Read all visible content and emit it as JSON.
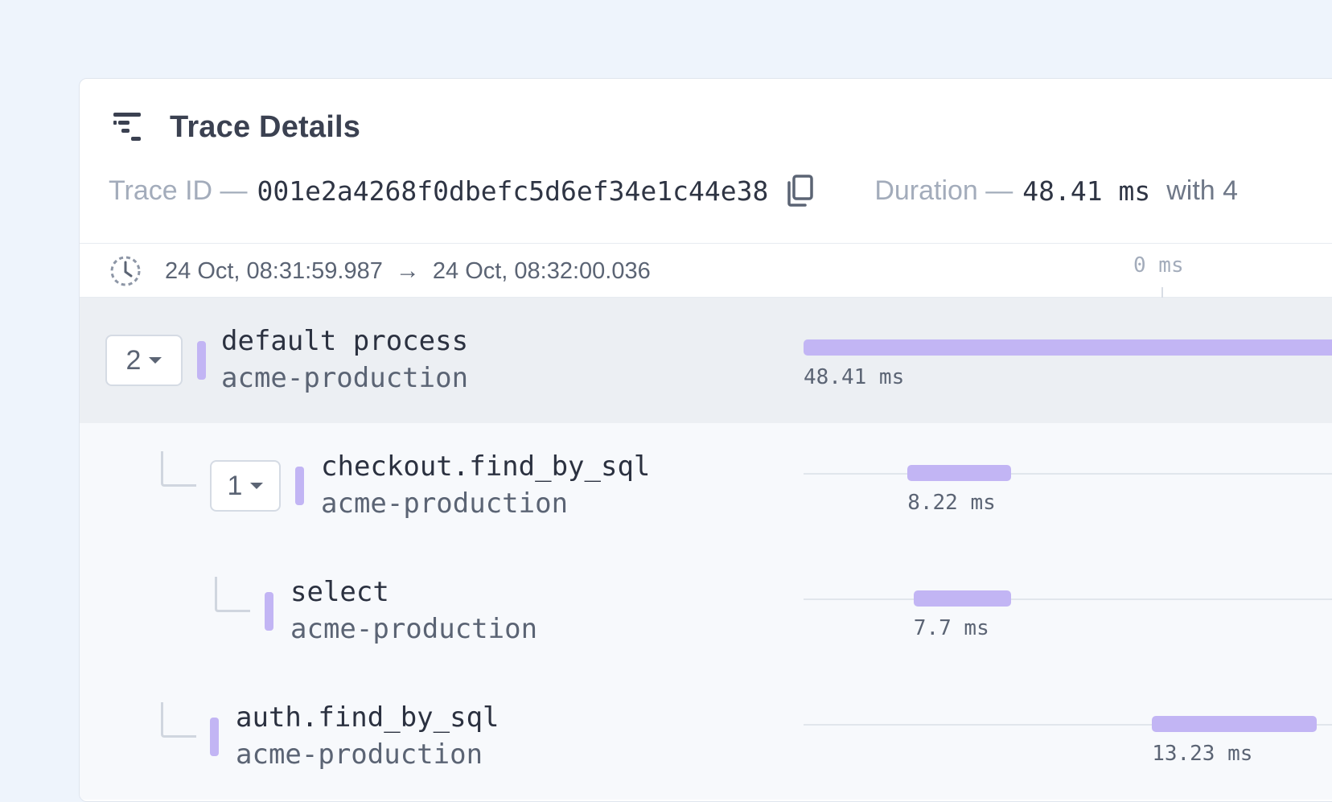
{
  "header": {
    "title": "Trace Details",
    "trace_id_label": "Trace ID —",
    "trace_id": "001e2a4268f0dbefc5d6ef34e1c44e38",
    "duration_label": "Duration —",
    "duration": "48.41 ms",
    "with_text": "with 4"
  },
  "time_range": {
    "start": "24 Oct, 08:31:59.987",
    "end": "24 Oct, 08:32:00.036",
    "timeline_start_label": "0 ms"
  },
  "spans": [
    {
      "name": "default process",
      "service": "acme-production",
      "duration": "48.41 ms",
      "children_count": "2",
      "offset_fraction": 0.0,
      "width_fraction": 1.0
    },
    {
      "name": "checkout.find_by_sql",
      "service": "acme-production",
      "duration": "8.22 ms",
      "children_count": "1",
      "offset_fraction": 0.17,
      "width_fraction": 0.17
    },
    {
      "name": "select",
      "service": "acme-production",
      "duration": "7.7 ms",
      "children_count": "",
      "offset_fraction": 0.18,
      "width_fraction": 0.16
    },
    {
      "name": "auth.find_by_sql",
      "service": "acme-production",
      "duration": "13.23 ms",
      "children_count": "",
      "offset_fraction": 0.57,
      "width_fraction": 0.27
    }
  ],
  "colors": {
    "span_bar": "#c2b5f4",
    "selected_row_bg": "#eceff3",
    "page_bg": "#eef4fc"
  },
  "icons": {
    "title": "trace-waterfall-icon",
    "copy": "copy-icon",
    "clock": "clock-icon",
    "arrow": "arrow-right-icon",
    "caret": "caret-down-icon"
  }
}
